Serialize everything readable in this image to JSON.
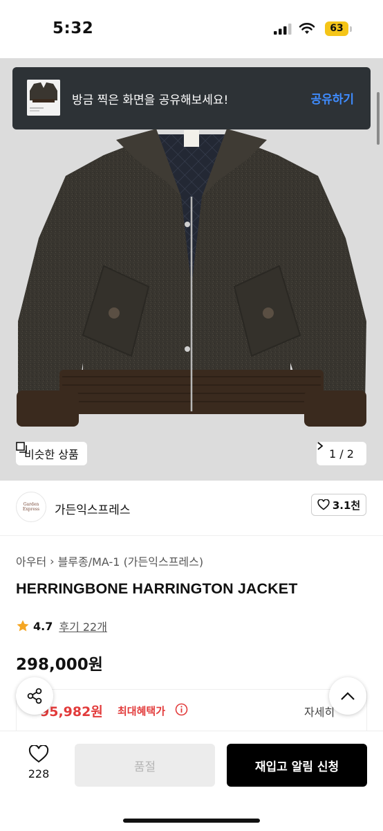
{
  "status_bar": {
    "time": "5:32",
    "battery": "63"
  },
  "toast": {
    "message": "방금 찍은 화면을 공유해보세요!",
    "action": "공유하기"
  },
  "gallery": {
    "similar_label": "비슷한 상품",
    "page_indicator": "1 / 2",
    "thumb_brand": "Garden Express"
  },
  "brand": {
    "name": "가든익스프레스",
    "logo_text": "Garden Express",
    "likes": "3.1천"
  },
  "breadcrumb": [
    "아우터",
    "블루종/MA-1 (가든익스프레스)"
  ],
  "product": {
    "title": "HERRINGBONE HARRINGTON JACKET",
    "rating": "4.7",
    "reviews": "후기 22개",
    "price": "298,000원"
  },
  "benefit": {
    "price": "95,982원",
    "label": "최대혜택가",
    "detail": "자세히"
  },
  "bottom": {
    "wish_count": "228",
    "soldout_label": "품절",
    "restock_label": "재입고 알림 신청"
  },
  "colors": {
    "accent_blue": "#3f8cff",
    "benefit_red": "#e23b3b",
    "star": "#f5a623",
    "battery": "#f5c518"
  }
}
